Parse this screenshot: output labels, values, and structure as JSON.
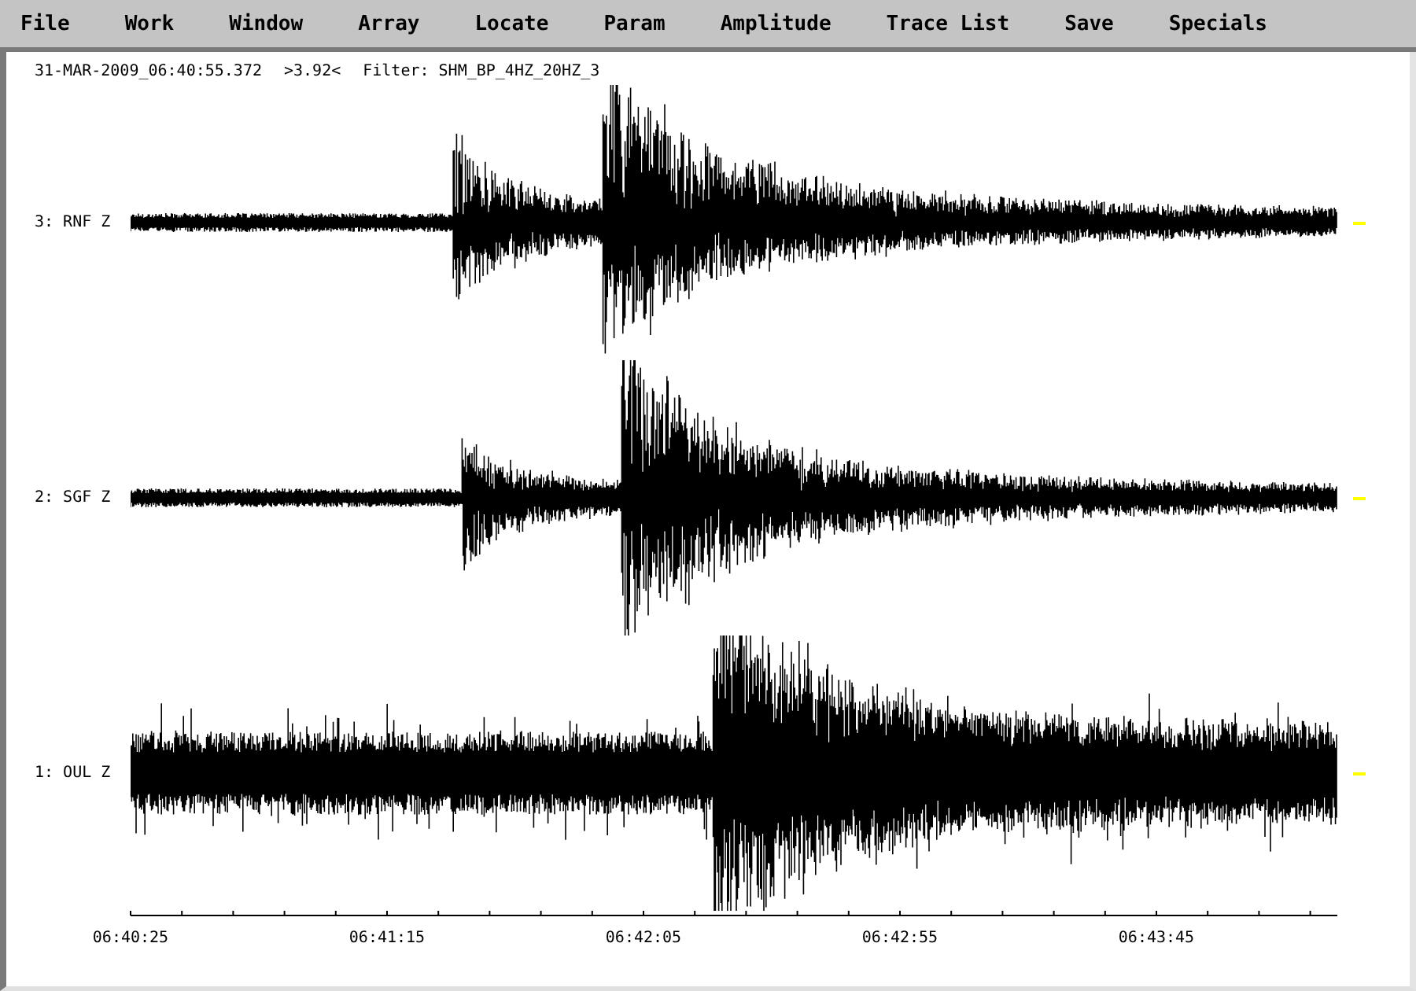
{
  "menu": [
    {
      "label": "File"
    },
    {
      "label": "Work"
    },
    {
      "label": "Window"
    },
    {
      "label": "Array"
    },
    {
      "label": "Locate"
    },
    {
      "label": "Param"
    },
    {
      "label": "Amplitude"
    },
    {
      "label": "Trace List"
    },
    {
      "label": "Save"
    },
    {
      "label": "Specials"
    }
  ],
  "header": {
    "start_time": "31-MAR-2009_06:40:55.372",
    "amplitude": ">3.92<",
    "filter": "Filter: SHM_BP_4HZ_20HZ_3"
  },
  "traces": [
    {
      "label": "3: RNF Z"
    },
    {
      "label": "2: SGF Z"
    },
    {
      "label": "1: OUL Z"
    }
  ],
  "time_axis": {
    "labels": [
      "06:40:25",
      "06:41:15",
      "06:42:05",
      "06:42:55",
      "06:43:45"
    ]
  }
}
